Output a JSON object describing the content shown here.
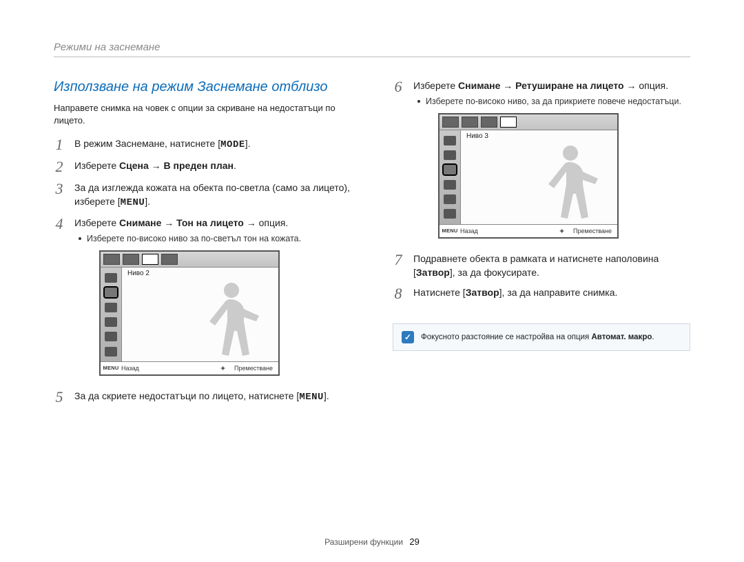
{
  "header": {
    "section": "Режими на заснемане"
  },
  "left": {
    "title": "Използване на режим Заснемане отблизо",
    "intro": "Направете снимка на човек с опции за скриване на недостатъци по лицето.",
    "steps": {
      "1": {
        "pre": "В режим Заснемане, натиснете [",
        "ui": "MODE",
        "post": "]."
      },
      "2": {
        "pre": "Изберете ",
        "b1": "Сцена",
        "arrow1": " → ",
        "b2": "В преден план",
        "post": "."
      },
      "3": {
        "pre": "За да изглежда кожата на обекта по-светла (само за лицето), изберете [",
        "ui": "MENU",
        "post": "]."
      },
      "4": {
        "pre": "Изберете ",
        "b1": "Снимане",
        "arrow1": " → ",
        "b2": "Тон на лицето",
        "arrow2": " → ",
        "post": "опция.",
        "bullet": "Изберете по-високо ниво за по-светъл тон на кожата."
      },
      "5": {
        "pre": "За да скриете недостатъци по лицето, натиснете [",
        "ui": "MENU",
        "post": "]."
      }
    },
    "lcd": {
      "level": "Ниво 2",
      "back_tag": "MENU",
      "back": "Назад",
      "move": "Преместване"
    }
  },
  "right": {
    "steps": {
      "6": {
        "pre": "Изберете ",
        "b1": "Снимане",
        "arrow1": " → ",
        "b2": "Ретуширане на лицето",
        "arrow2": " → ",
        "post": "опция.",
        "bullet": "Изберете по-високо ниво, за да прикриете повече недостатъци."
      },
      "7": {
        "pre": "Подравнете обекта в рамката и натиснете наполовина [",
        "ui": "Затвор",
        "post": "], за да фокусирате."
      },
      "8": {
        "pre": "Натиснете [",
        "ui": "Затвор",
        "post": "], за да направите снимка."
      }
    },
    "lcd": {
      "level": "Ниво 3",
      "back_tag": "MENU",
      "back": "Назад",
      "move": "Преместване"
    },
    "note": {
      "pre": "Фокусното разстояние се настройва на опция ",
      "b": "Автомат. макро",
      "post": "."
    }
  },
  "footer": {
    "text": "Разширени функции",
    "page": "29"
  }
}
